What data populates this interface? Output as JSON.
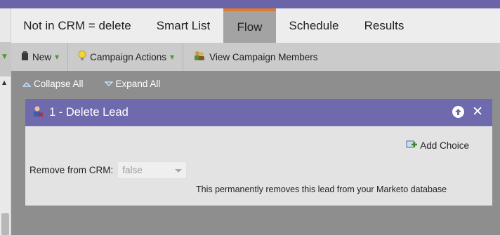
{
  "tabs": [
    {
      "label": "Not in CRM = delete"
    },
    {
      "label": "Smart List"
    },
    {
      "label": "Flow"
    },
    {
      "label": "Schedule"
    },
    {
      "label": "Results"
    }
  ],
  "active_tab": "Flow",
  "toolbar": {
    "new_label": "New",
    "campaign_actions_label": "Campaign Actions",
    "view_members_label": "View Campaign Members"
  },
  "collapse_label": "Collapse All",
  "expand_label": "Expand All",
  "step": {
    "title": "1 - Delete Lead",
    "add_choice_label": "Add Choice",
    "field_label": "Remove from CRM:",
    "field_value": "false",
    "description": "This permanently removes this lead from your Marketo database"
  },
  "colors": {
    "header_purple": "#6f69ad",
    "active_tab_accent": "#e07b2e",
    "toolbar_bg": "#cbcbcb",
    "canvas_bg": "#8e8e8e"
  },
  "icons": [
    "new-icon",
    "lightbulb-icon",
    "campaign-members-icon",
    "collapse-icon",
    "expand-icon",
    "delete-lead-icon",
    "move-up-icon",
    "close-icon",
    "add-choice-icon"
  ]
}
